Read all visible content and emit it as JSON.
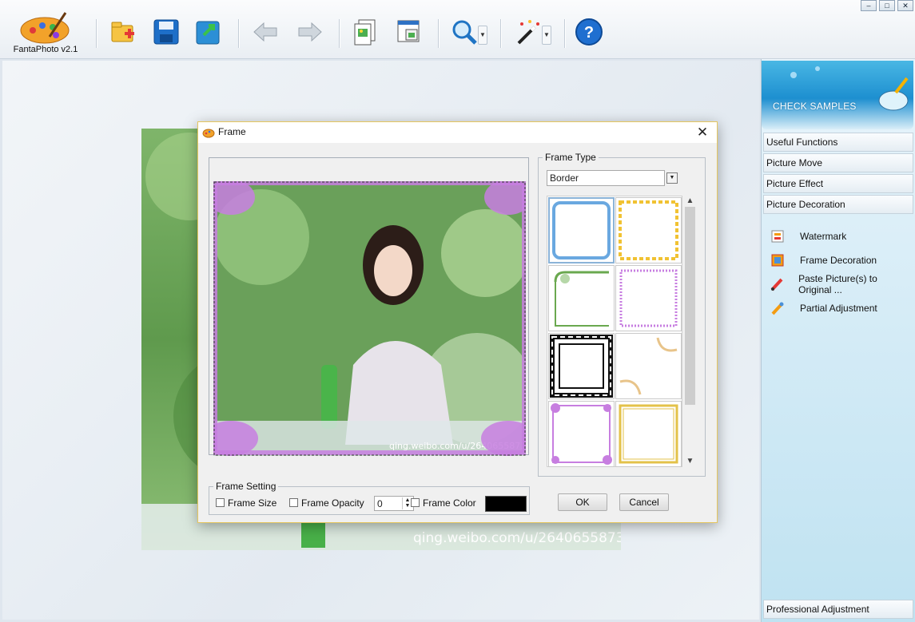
{
  "app": {
    "name": "FantaPhoto v2.1"
  },
  "toolbar": {
    "buttons": [
      {
        "name": "open",
        "icon": "open-folder-icon"
      },
      {
        "name": "save",
        "icon": "save-icon"
      },
      {
        "name": "export",
        "icon": "export-icon"
      },
      {
        "name": "undo",
        "icon": "undo-arrow-icon"
      },
      {
        "name": "redo",
        "icon": "redo-arrow-icon"
      },
      {
        "name": "batch",
        "icon": "batch-copy-icon"
      },
      {
        "name": "window",
        "icon": "window-icon"
      },
      {
        "name": "zoom",
        "icon": "magnifier-icon"
      },
      {
        "name": "magic",
        "icon": "magic-wand-icon"
      },
      {
        "name": "help",
        "icon": "help-icon",
        "glyph": "?"
      }
    ]
  },
  "window_controls": {
    "minimize": "–",
    "maximize": "□",
    "close": "✕"
  },
  "canvas": {
    "watermark": "qing.weibo.com/u/2640655873"
  },
  "right_panel": {
    "samples_label": "CHECK SAMPLES",
    "categories": [
      "Useful Functions",
      "Picture Move",
      "Picture Effect",
      "Picture Decoration"
    ],
    "decoration_items": [
      "Watermark",
      "Frame Decoration",
      "Paste Picture(s) to Original ...",
      "Partial Adjustment"
    ],
    "footer": "Professional Adjustment"
  },
  "dialog": {
    "title": "Frame",
    "close": "✕",
    "frame_type_label": "Frame Type",
    "frame_type_value": "Border",
    "frame_setting_label": "Frame Setting",
    "frame_size_label": "Frame Size",
    "frame_opacity_label": "Frame Opacity",
    "frame_opacity_value": "0",
    "frame_color_label": "Frame Color",
    "frame_color_value": "#000000",
    "ok": "OK",
    "cancel": "Cancel",
    "preview_watermark": "qing.weibo.com/u/2640655873",
    "scroll_up": "▲",
    "scroll_down": "▼"
  },
  "colors": {
    "accent": "#1d8fd0",
    "frame_purple": "#c77ee0",
    "dialog_border": "#e5c65f"
  }
}
